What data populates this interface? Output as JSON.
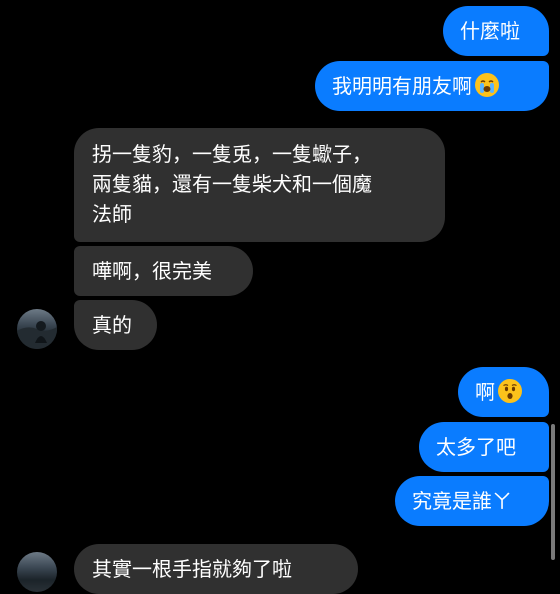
{
  "outgoing": [
    {
      "text": "什麼啦"
    },
    {
      "text": "我明明有朋友啊",
      "emoji": "loudly-crying-face"
    },
    {
      "text": "啊",
      "emoji": "hushed-face"
    },
    {
      "text": "太多了吧"
    },
    {
      "text": "究竟是誰ㄚ"
    }
  ],
  "incoming": [
    {
      "lines": [
        "拐一隻豹，一隻兎，一隻蠍子，",
        "兩隻貓，還有一隻柴犬和一個魔",
        "法師"
      ]
    },
    {
      "lines": [
        "嘩啊，很完美"
      ]
    },
    {
      "lines": [
        "真的"
      ]
    }
  ],
  "partial_message": {
    "text": "其實一根手指就夠了啦"
  },
  "colors": {
    "background": "#000000",
    "outgoing_bubble": "#0a7cff",
    "incoming_bubble": "#303030",
    "text": "#ffffff"
  }
}
